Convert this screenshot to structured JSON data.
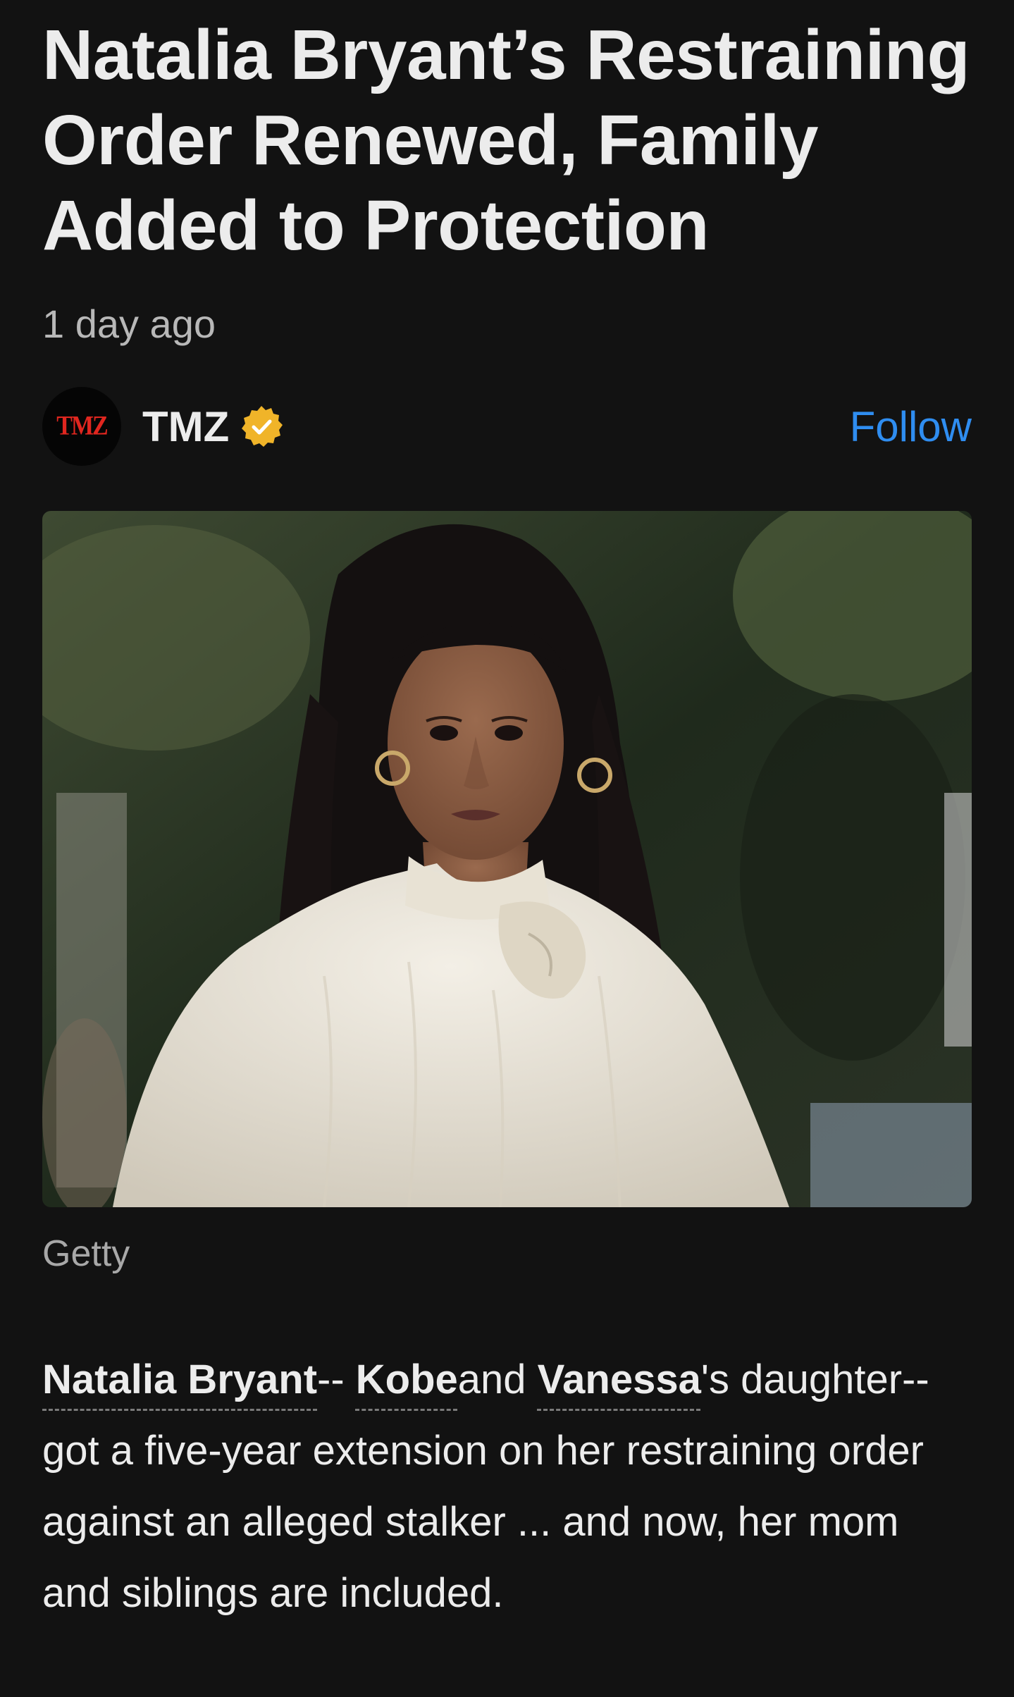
{
  "article": {
    "headline": "Natalia Bryant’s Restraining Order Renewed, Family Added to Protection",
    "timestamp": "1 day ago"
  },
  "publisher": {
    "avatar_text": "TMZ",
    "name": "TMZ",
    "verified_icon": "verified-badge-icon",
    "follow_label": "Follow"
  },
  "image": {
    "caption": "Getty"
  },
  "body": {
    "link_natalia": "Natalia Bryant",
    "sep1": "-- ",
    "link_kobe": "Kobe",
    "and_text": "and ",
    "link_vanessa": "Vanessa",
    "rest": "'s daughter-- got a five-year extension on her restraining order against an alleged stalker ... and now, her mom and siblings are included."
  },
  "colors": {
    "background": "#121212",
    "accent": "#2f8df0",
    "badge": "#f0b429",
    "brand_red": "#e0261f"
  }
}
